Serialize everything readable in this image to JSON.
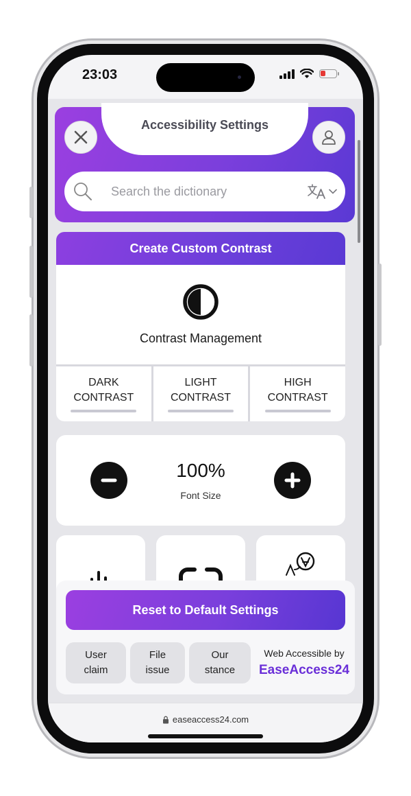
{
  "status_bar": {
    "time": "23:03"
  },
  "header": {
    "title": "Accessibility Settings"
  },
  "search": {
    "placeholder": "Search the dictionary"
  },
  "contrast": {
    "title": "Create Custom Contrast",
    "label": "Contrast Management",
    "options": [
      {
        "line1": "DARK",
        "line2": "CONTRAST"
      },
      {
        "line1": "LIGHT",
        "line2": "CONTRAST"
      },
      {
        "line1": "HIGH",
        "line2": "CONTRAST"
      }
    ]
  },
  "font_size": {
    "value": "100%",
    "label": "Font Size"
  },
  "footer": {
    "reset_label": "Reset to Default Settings",
    "links": [
      {
        "line1": "User",
        "line2": "claim"
      },
      {
        "line1": "File",
        "line2": "issue"
      },
      {
        "line1": "Our",
        "line2": "stance"
      }
    ],
    "brand_top": "Web Accessible by",
    "brand_name": "EaseAccess24"
  },
  "browser": {
    "url": "easeaccess24.com"
  },
  "colors": {
    "accent": "#7b3fdc",
    "accent_dark": "#5a39d4",
    "brand_text": "#6a2fd8",
    "battery_low": "#e53935"
  }
}
